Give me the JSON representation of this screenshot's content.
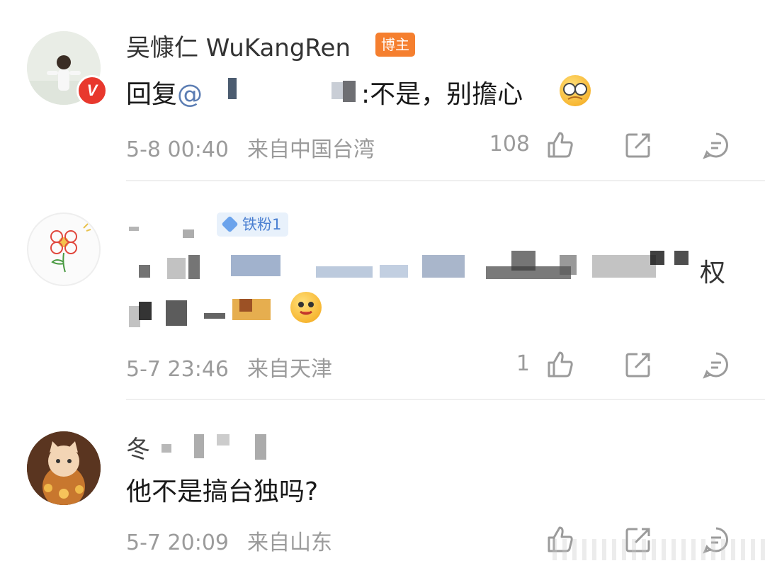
{
  "comments": [
    {
      "author": "吴慷仁 WuKangRen",
      "badge": "博主",
      "verified_mark": "V",
      "reply_prefix": "回复",
      "mention": "@",
      "text": ":不是，别擔心",
      "time": "5-8 00:40",
      "location": "来自中国台湾",
      "likes": "108"
    },
    {
      "author": "",
      "badge": "铁粉1",
      "text_line1": "权",
      "time": "5-7 23:46",
      "location": "来自天津",
      "likes": "1"
    },
    {
      "author": "冬",
      "text": "他不是搞台独吗?",
      "time": "5-7 20:09",
      "location": "来自山东",
      "likes": ""
    }
  ],
  "icons": [
    "like-icon",
    "repost-icon",
    "comment-icon",
    "emoji-icon",
    "verified-icon"
  ],
  "colors": {
    "blogger_badge": "#f57f2f",
    "fan_badge_bg": "#e8f1fb",
    "fan_badge_text": "#4a7fd1",
    "verified": "#e8382d",
    "mention": "#5b7db3",
    "meta_gray": "#9b9b9b"
  }
}
